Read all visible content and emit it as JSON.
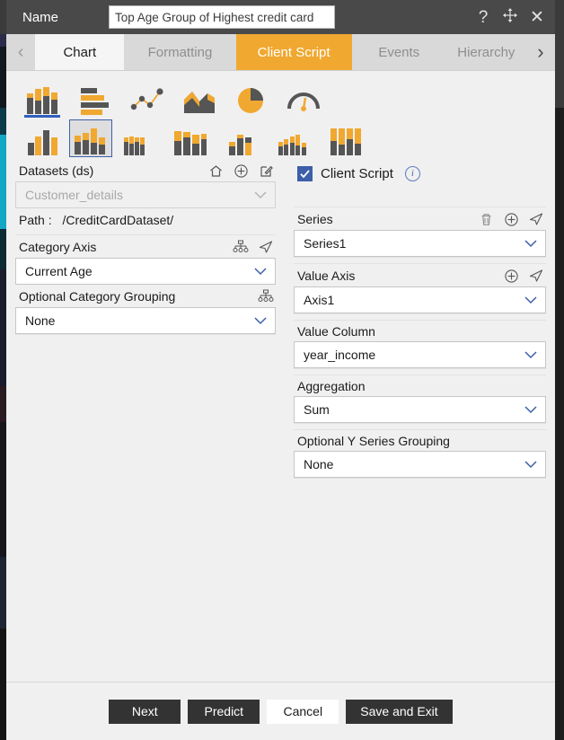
{
  "titlebar": {
    "name_label": "Name",
    "name_value": "Top Age Group of Highest credit card",
    "name_placeholder": "Name",
    "help_icon": "question-mark-icon",
    "move_icon": "move-icon",
    "close_icon": "close-icon"
  },
  "tabs": {
    "prev_arrow": "‹",
    "next_arrow": "›",
    "items": [
      {
        "label": "Chart",
        "state": "active"
      },
      {
        "label": "Formatting",
        "state": "normal"
      },
      {
        "label": "Client Script",
        "state": "highlight"
      },
      {
        "label": "Events",
        "state": "normal"
      },
      {
        "label": "Hierarchy",
        "state": "normal"
      }
    ]
  },
  "chart_types": {
    "row1": [
      {
        "name": "column-chart-icon",
        "selected": true
      },
      {
        "name": "bar-chart-icon",
        "selected": false
      },
      {
        "name": "line-scatter-chart-icon",
        "selected": false
      },
      {
        "name": "area-chart-icon",
        "selected": false
      },
      {
        "name": "pie-chart-icon",
        "selected": false
      },
      {
        "name": "gauge-chart-icon",
        "selected": false
      }
    ],
    "row2": [
      {
        "name": "clustered-column-icon",
        "selected": false
      },
      {
        "name": "stacked-column-icon",
        "selected": true
      },
      {
        "name": "stacked-grouped-column-icon",
        "selected": false
      },
      {
        "name": "stacked-column-wide-icon",
        "selected": false
      },
      {
        "name": "overlapped-column-icon",
        "selected": false
      },
      {
        "name": "small-multiples-column-icon",
        "selected": false
      },
      {
        "name": "full-stacked-column-icon",
        "selected": false
      }
    ]
  },
  "datasets": {
    "label": "Datasets (ds)",
    "home_icon": "home-icon",
    "add_icon": "plus-circle-icon",
    "edit_icon": "edit-icon",
    "value": "Customer_details",
    "path_label": "Path :",
    "path_value": "/CreditCardDataset/"
  },
  "client_script": {
    "label": "Client Script",
    "checked": true,
    "info_icon": "info-icon"
  },
  "category_axis": {
    "label": "Category Axis",
    "tree_icon": "hierarchy-tree-icon",
    "send_icon": "send-arrow-icon",
    "value": "Current Age"
  },
  "category_grouping": {
    "label": "Optional Category Grouping",
    "tree_icon": "hierarchy-tree-icon",
    "value": "None"
  },
  "series": {
    "label": "Series",
    "delete_icon": "trash-icon",
    "add_icon": "plus-circle-icon",
    "send_icon": "send-arrow-icon",
    "value": "Series1"
  },
  "value_axis": {
    "label": "Value Axis",
    "add_icon": "plus-circle-icon",
    "send_icon": "send-arrow-icon",
    "value": "Axis1"
  },
  "value_column": {
    "label": "Value Column",
    "value": "year_income"
  },
  "aggregation": {
    "label": "Aggregation",
    "value": "Sum"
  },
  "y_series_grouping": {
    "label": "Optional Y Series Grouping",
    "value": "None"
  },
  "footer": {
    "next_label": "Next",
    "predict_label": "Predict",
    "cancel_label": "Cancel",
    "save_exit_label": "Save and Exit"
  },
  "colors": {
    "accent_orange": "#f0a830",
    "titlebar": "#494949",
    "tabbar": "#d9d9d9",
    "select_blue": "#3c5fa8",
    "button_dark": "#333333",
    "panel_bg": "#f0f0f0"
  }
}
